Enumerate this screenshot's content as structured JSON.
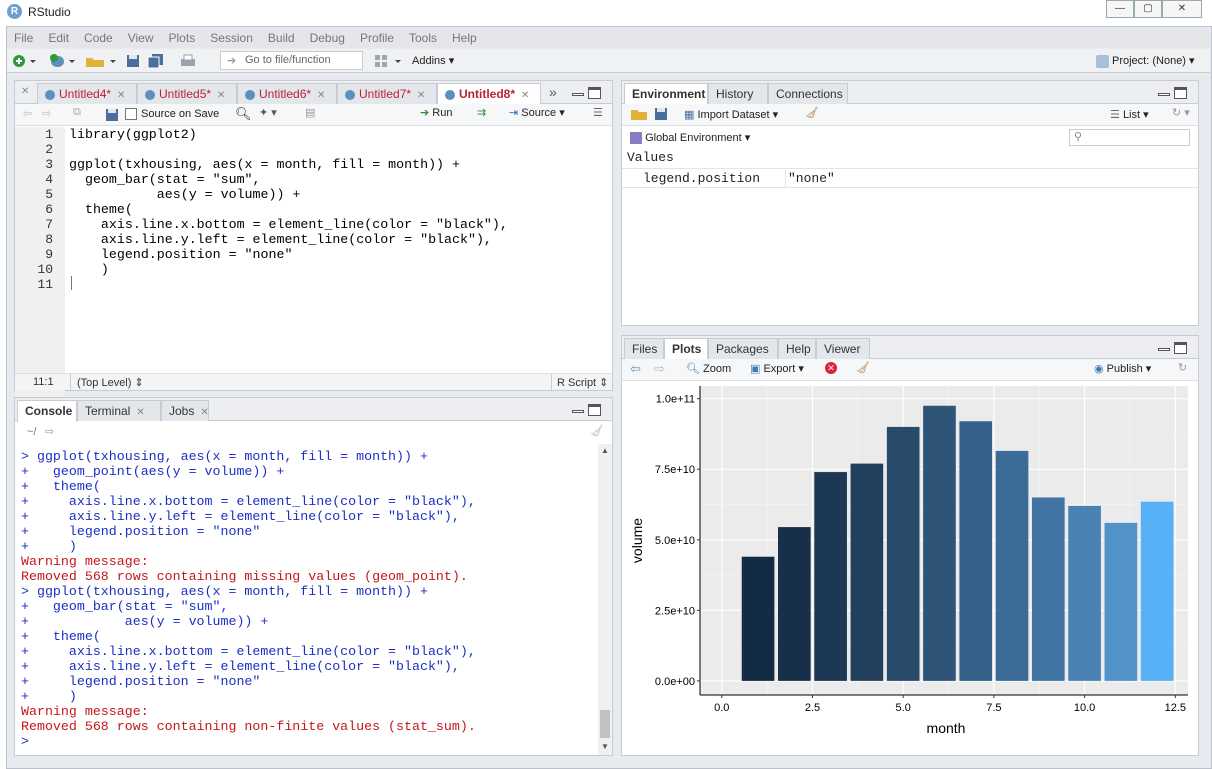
{
  "window": {
    "title": "RStudio",
    "icon_letter": "R"
  },
  "menu": [
    "File",
    "Edit",
    "Code",
    "View",
    "Plots",
    "Session",
    "Build",
    "Debug",
    "Profile",
    "Tools",
    "Help"
  ],
  "toolbar": {
    "goto_placeholder": "Go to file/function",
    "addins": "Addins",
    "project": "Project: (None)"
  },
  "editor": {
    "tabs": [
      "Untitled4*",
      "Untitled5*",
      "Untitled6*",
      "Untitled7*",
      "Untitled8*"
    ],
    "source_on_save": "Source on Save",
    "run": "Run",
    "source": "Source",
    "code_lines": [
      "library(ggplot2)",
      "",
      "ggplot(txhousing, aes(x = month, fill = month)) +",
      "  geom_bar(stat = \"sum\",",
      "           aes(y = volume)) +",
      "  theme(",
      "    axis.line.x.bottom = element_line(color = \"black\"),",
      "    axis.line.y.left = element_line(color = \"black\"),",
      "    legend.position = \"none\"",
      "    )",
      ""
    ],
    "line_numbers": [
      "1",
      "2",
      "3",
      "4",
      "5",
      "6",
      "7",
      "8",
      "9",
      "10",
      "11"
    ],
    "status_pos": "11:1",
    "status_scope": "(Top Level)",
    "status_type": "R Script"
  },
  "console": {
    "tabs": [
      "Console",
      "Terminal",
      "Jobs"
    ],
    "path": "~/",
    "lines": [
      {
        "t": "> ggplot(txhousing, aes(x = month, fill = month)) +",
        "c": "blue"
      },
      {
        "t": "+   geom_point(aes(y = volume)) +",
        "c": "blue"
      },
      {
        "t": "+   theme(",
        "c": "blue"
      },
      {
        "t": "+     axis.line.x.bottom = element_line(color = \"black\"),",
        "c": "blue"
      },
      {
        "t": "+     axis.line.y.left = element_line(color = \"black\"),",
        "c": "blue"
      },
      {
        "t": "+     legend.position = \"none\"",
        "c": "blue"
      },
      {
        "t": "+     )",
        "c": "blue"
      },
      {
        "t": "Warning message:",
        "c": "red"
      },
      {
        "t": "Removed 568 rows containing missing values (geom_point).",
        "c": "red"
      },
      {
        "t": "> ggplot(txhousing, aes(x = month, fill = month)) +",
        "c": "blue"
      },
      {
        "t": "+   geom_bar(stat = \"sum\",",
        "c": "blue"
      },
      {
        "t": "+            aes(y = volume)) +",
        "c": "blue"
      },
      {
        "t": "+   theme(",
        "c": "blue"
      },
      {
        "t": "+     axis.line.x.bottom = element_line(color = \"black\"),",
        "c": "blue"
      },
      {
        "t": "+     axis.line.y.left = element_line(color = \"black\"),",
        "c": "blue"
      },
      {
        "t": "+     legend.position = \"none\"",
        "c": "blue"
      },
      {
        "t": "+     )",
        "c": "blue"
      },
      {
        "t": "Warning message:",
        "c": "red"
      },
      {
        "t": "Removed 568 rows containing non-finite values (stat_sum).",
        "c": "red"
      },
      {
        "t": "> ",
        "c": "blue"
      }
    ]
  },
  "environment": {
    "tabs": [
      "Environment",
      "History",
      "Connections"
    ],
    "import_dataset": "Import Dataset",
    "list_view": "List",
    "global_env": "Global Environment",
    "section": "Values",
    "values": [
      {
        "name": "legend.position",
        "value": "\"none\""
      }
    ]
  },
  "files": {
    "tabs": [
      "Files",
      "Plots",
      "Packages",
      "Help",
      "Viewer"
    ],
    "zoom": "Zoom",
    "export": "Export",
    "publish": "Publish"
  },
  "chart_data": {
    "type": "bar",
    "x": [
      1,
      2,
      3,
      4,
      5,
      6,
      7,
      8,
      9,
      10,
      11,
      12
    ],
    "values": [
      44000000000.0,
      54500000000.0,
      74000000000.0,
      77000000000.0,
      90000000000.0,
      97500000000.0,
      92000000000.0,
      81500000000.0,
      65000000000.0,
      62000000000.0,
      56000000000.0,
      63500000000.0
    ],
    "colors": [
      "#132b43",
      "#182f4a",
      "#1d3855",
      "#22405e",
      "#284a6b",
      "#2e5478",
      "#356088",
      "#3b6b97",
      "#4274a4",
      "#4a82b5",
      "#5192c8",
      "#56b1f7"
    ],
    "xlabel": "month",
    "ylabel": "volume",
    "xlim": [
      0,
      12.5
    ],
    "ylim": [
      0,
      100000000000.0
    ],
    "x_ticks": [
      "0.0",
      "2.5",
      "5.0",
      "7.5",
      "10.0",
      "12.5"
    ],
    "x_tick_values": [
      0,
      2.5,
      5,
      7.5,
      10,
      12.5
    ],
    "y_ticks": [
      "0.0e+00",
      "2.5e+10",
      "5.0e+10",
      "7.5e+10",
      "1.0e+11"
    ],
    "y_tick_values": [
      0,
      25000000000.0,
      50000000000.0,
      75000000000.0,
      100000000000.0
    ],
    "grid": true,
    "legend": "none"
  }
}
